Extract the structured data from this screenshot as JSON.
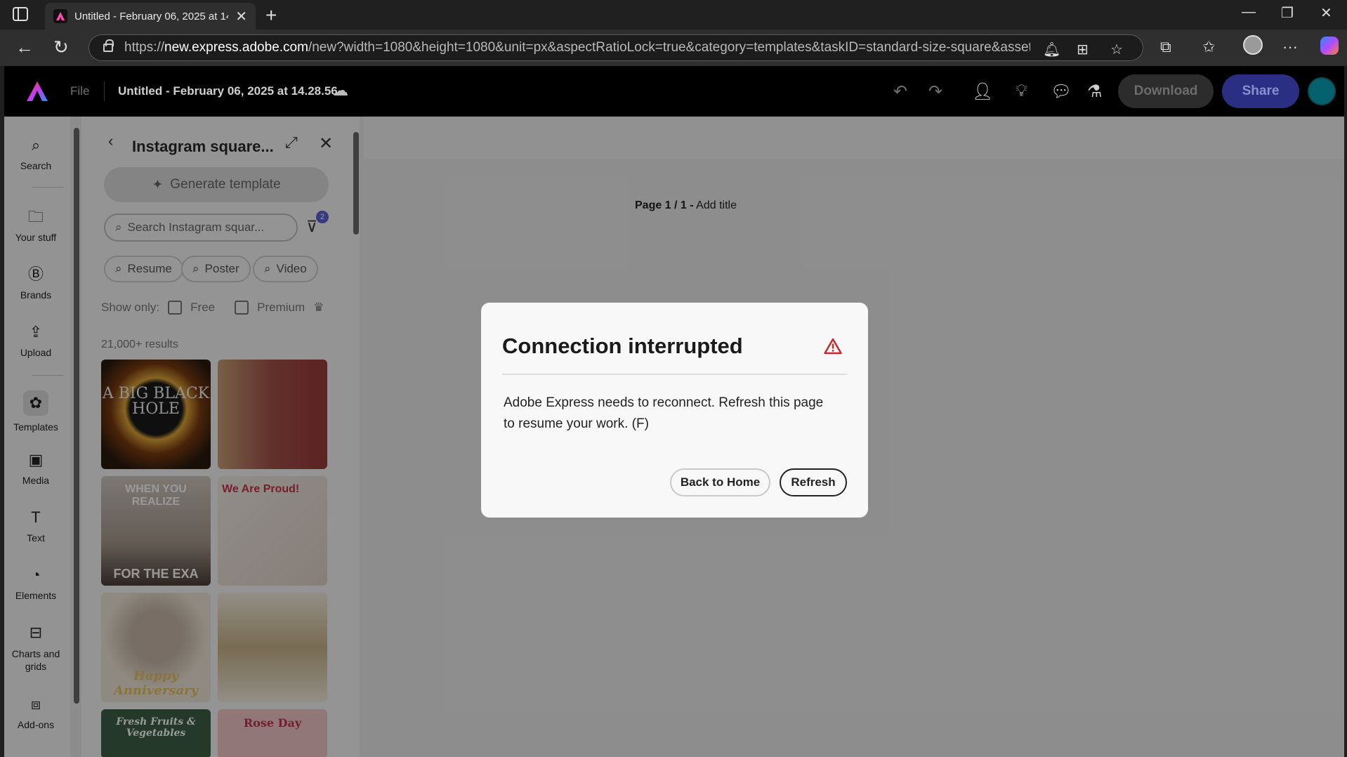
{
  "browser": {
    "tab_title": "Untitled - February 06, 2025 at 14",
    "url_prefix": "https://",
    "url_host": "new.express.adobe.com",
    "url_rest": "/new?width=1080&height=1080&unit=px&aspectRatioLock=true&category=templates&taskID=standard-size-square&assetCollec..."
  },
  "header": {
    "file_label": "File",
    "doc_title": "Untitled - February 06, 2025 at 14.28.56",
    "download_label": "Download",
    "share_label": "Share"
  },
  "rail": {
    "items": [
      {
        "label": "Search",
        "icon": "search-icon"
      },
      {
        "label": "Your stuff",
        "icon": "folder-icon"
      },
      {
        "label": "Brands",
        "icon": "brand-icon"
      },
      {
        "label": "Upload",
        "icon": "upload-icon"
      },
      {
        "label": "Templates",
        "icon": "templates-icon"
      },
      {
        "label": "Media",
        "icon": "media-icon"
      },
      {
        "label": "Text",
        "icon": "text-icon"
      },
      {
        "label": "Elements",
        "icon": "elements-icon"
      },
      {
        "label": "Charts and grids",
        "icon": "charts-icon"
      },
      {
        "label": "Add-ons",
        "icon": "addons-icon"
      }
    ]
  },
  "panel": {
    "title": "Instagram square...",
    "generate_label": "Generate template",
    "search_placeholder": "Search Instagram squar...",
    "filter_count": "2",
    "chips": [
      "Resume",
      "Poster",
      "Video"
    ],
    "show_only_label": "Show only:",
    "free_label": "Free",
    "premium_label": "Premium",
    "results_label": "21,000+ results",
    "thumbs": [
      {
        "text": "A BIG BLACK HOLE"
      },
      {
        "text": ""
      },
      {
        "text": "WHEN YOU REALIZE",
        "footer": "FOR THE EXA"
      },
      {
        "text": "We Are Proud!"
      },
      {
        "text": "Happy Anniversary"
      },
      {
        "text": ""
      },
      {
        "text": "Fresh Fruits & Vegetables"
      },
      {
        "text": "Rose Day"
      }
    ]
  },
  "canvas": {
    "page_label": "Page 1 / 1 -",
    "add_title": "Add title"
  },
  "modal": {
    "title": "Connection interrupted",
    "body": "Adobe Express needs to reconnect. Refresh this page to resume your work. (F)",
    "back_home_label": "Back to Home",
    "refresh_label": "Refresh"
  },
  "colors": {
    "share_button": "#2b2f83",
    "warning_icon": "#c9252c"
  }
}
